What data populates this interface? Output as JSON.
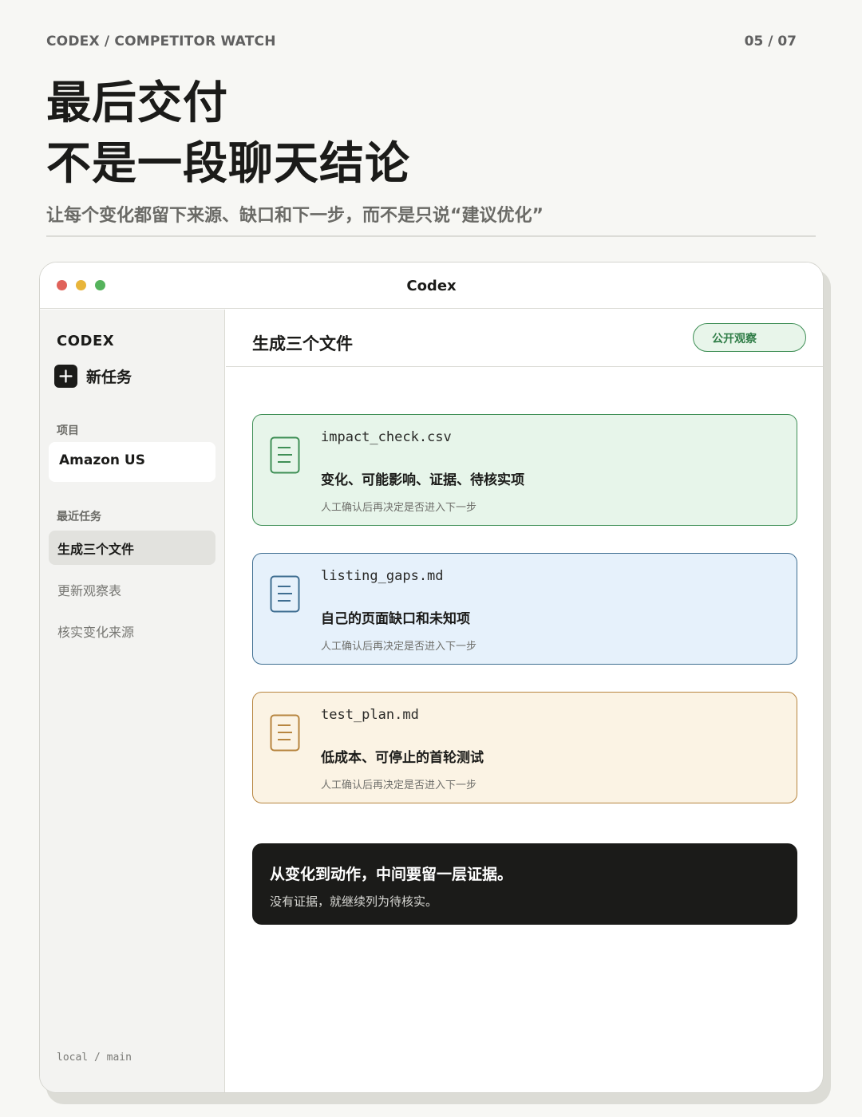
{
  "header": {
    "eyebrow": "CODEX / COMPETITOR WATCH",
    "page_indicator": "05 / 07",
    "title_line1": "最后交付",
    "title_line2": "不是一段聊天结论",
    "subtitle": "让每个变化都留下来源、缺口和下一步，而不是只说“建议优化”"
  },
  "window": {
    "title": "Codex"
  },
  "sidebar": {
    "brand": "CODEX",
    "new_task_label": "新任务",
    "projects_label": "项目",
    "project": "Amazon US",
    "recent_label": "最近任务",
    "tasks": [
      {
        "label": "生成三个文件",
        "active": true
      },
      {
        "label": "更新观察表",
        "active": false
      },
      {
        "label": "核实变化来源",
        "active": false
      }
    ],
    "branch": "local / main"
  },
  "main": {
    "title": "生成三个文件",
    "badge": "公开观察",
    "files": [
      {
        "name": "impact_check.csv",
        "description": "变化、可能影响、证据、待核实项",
        "note": "人工确认后再决定是否进入下一步",
        "color": "#3f8f56"
      },
      {
        "name": "listing_gaps.md",
        "description": "自己的页面缺口和未知项",
        "note": "人工确认后再决定是否进入下一步",
        "color": "#3f6e91"
      },
      {
        "name": "test_plan.md",
        "description": "低成本、可停止的首轮测试",
        "note": "人工确认后再决定是否进入下一步",
        "color": "#b7853f"
      }
    ],
    "callout": {
      "title": "从变化到动作，中间要留一层证据。",
      "subtitle": "没有证据，就继续列为待核实。"
    }
  },
  "icons": [
    "plus-icon",
    "document-icon"
  ]
}
